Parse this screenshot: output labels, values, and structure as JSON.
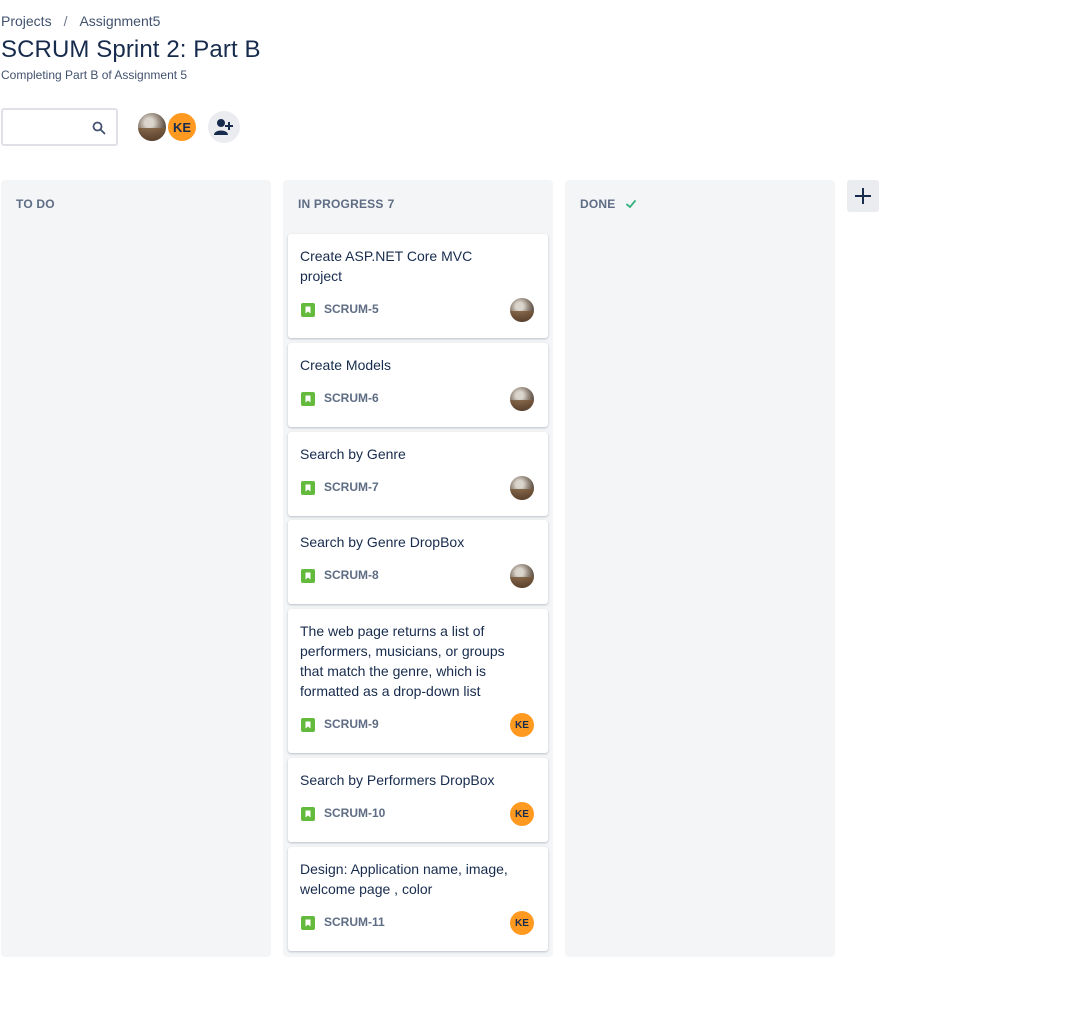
{
  "breadcrumb": {
    "projects": "Projects",
    "separator": "/",
    "project": "Assignment5"
  },
  "board": {
    "title": "SCRUM Sprint 2: Part B",
    "subtitle": "Completing Part B of Assignment 5"
  },
  "search": {
    "value": "",
    "placeholder": ""
  },
  "header_avatars": [
    {
      "type": "photo",
      "initials": ""
    },
    {
      "type": "initials",
      "initials": "KE"
    }
  ],
  "icons": {
    "search": "search-icon",
    "add_people": "add-person-icon",
    "add_column": "plus-icon",
    "done_check": "check-icon",
    "story": "story-icon"
  },
  "columns": [
    {
      "title": "TO DO",
      "count": ""
    },
    {
      "title": "IN PROGRESS",
      "count": "7"
    },
    {
      "title": "DONE",
      "count": ""
    }
  ],
  "cards": [
    {
      "summary": "Create ASP.NET Core MVC project",
      "key": "SCRUM-5",
      "assignee": "photo",
      "initials": ""
    },
    {
      "summary": "Create Models",
      "key": "SCRUM-6",
      "assignee": "photo",
      "initials": ""
    },
    {
      "summary": "Search by Genre",
      "key": "SCRUM-7",
      "assignee": "photo",
      "initials": ""
    },
    {
      "summary": "Search by Genre DropBox",
      "key": "SCRUM-8",
      "assignee": "photo",
      "initials": ""
    },
    {
      "summary": "The web page returns a list of performers, musicians, or groups that match the genre, which is formatted as a drop-down list",
      "key": "SCRUM-9",
      "assignee": "initials",
      "initials": "KE"
    },
    {
      "summary": "Search by Performers DropBox",
      "key": "SCRUM-10",
      "assignee": "initials",
      "initials": "KE"
    },
    {
      "summary": "Design: Application name, image, welcome page , color",
      "key": "SCRUM-11",
      "assignee": "initials",
      "initials": "KE"
    }
  ],
  "colors": {
    "text_primary": "#172b4d",
    "text_secondary": "#5e6c84",
    "column_bg": "#f4f5f7",
    "story_green": "#63ba3c",
    "avatar_orange": "#ff991f",
    "done_check_green": "#36b37e"
  }
}
